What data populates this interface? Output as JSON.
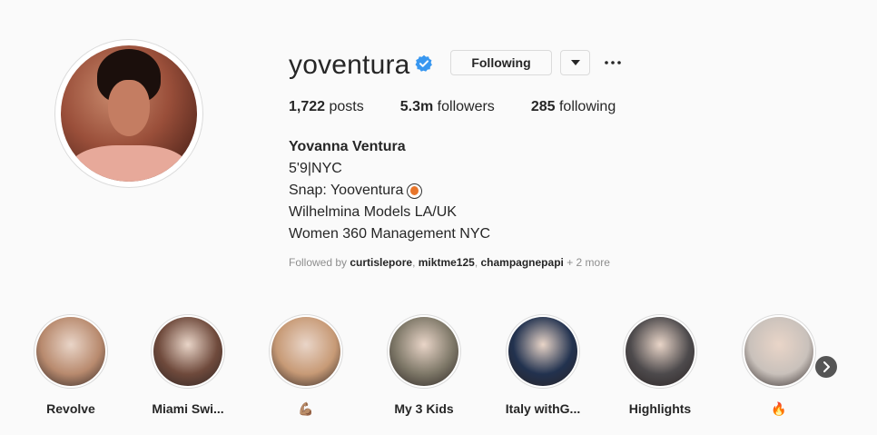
{
  "profile": {
    "username": "yoventura",
    "following_label": "Following",
    "stats": {
      "posts_count": "1,722",
      "posts_label": "posts",
      "followers_count": "5.3m",
      "followers_label": "followers",
      "following_count": "285",
      "following_label": "following"
    },
    "bio": {
      "full_name": "Yovanna Ventura",
      "line1": "5'9|NYC",
      "line2": "Snap: Yooventura",
      "line3": "Wilhelmina Models LA/UK",
      "line4": "Women 360 Management NYC"
    },
    "followed_by": {
      "prefix": "Followed by",
      "users": [
        "curtislepore",
        "miktme125",
        "champagnepapi"
      ],
      "sep": ",",
      "more": "+ 2 more"
    }
  },
  "highlights": [
    {
      "label": "Revolve",
      "color": "#b88a6e"
    },
    {
      "label": "Miami Swi...",
      "color": "#6f4a3c"
    },
    {
      "label": "💪🏽",
      "color": "#c79a76"
    },
    {
      "label": "My 3 Kids",
      "color": "#7d7767"
    },
    {
      "label": "Italy withG...",
      "color": "#22324f"
    },
    {
      "label": "Highlights",
      "color": "#4d4a4c"
    },
    {
      "label": "🔥",
      "color": "#c9c1bb"
    }
  ],
  "colors": {
    "verified": "#3897f0",
    "text": "#262626",
    "muted": "#8e8e8e"
  }
}
